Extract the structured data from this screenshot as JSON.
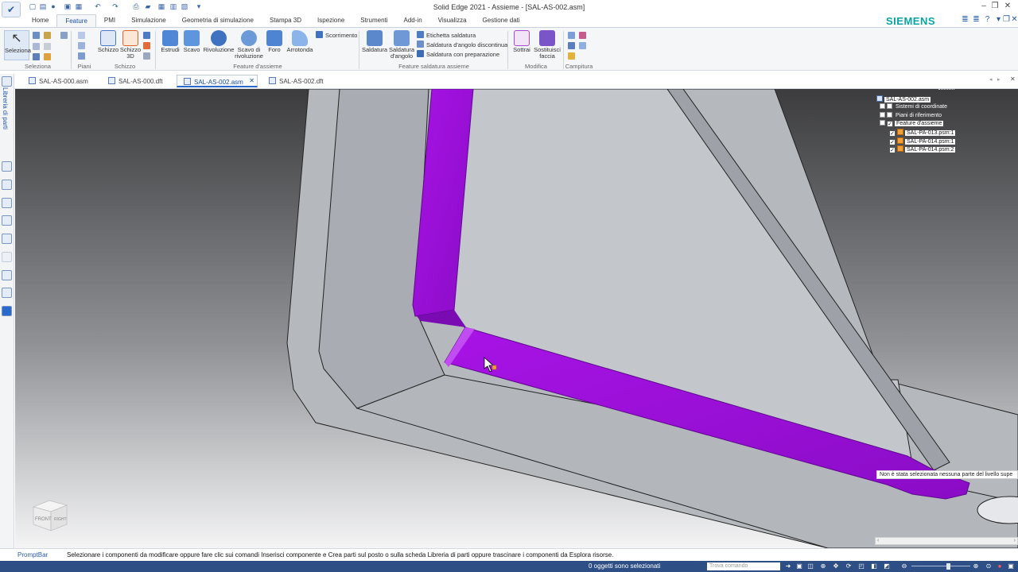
{
  "window": {
    "title": "Solid Edge 2021 - Assieme - [SAL-AS-002.asm]",
    "brand": "SIEMENS",
    "brand_color": "#0aa3a3",
    "accent_color": "#2a5ca8"
  },
  "ribbon": {
    "tabs": [
      "Home",
      "Feature",
      "PMI",
      "Simulazione",
      "Geometria di simulazione",
      "Stampa 3D",
      "Ispezione",
      "Strumenti",
      "Add-in",
      "Visualizza",
      "Gestione dati"
    ],
    "active_tab": "Feature",
    "groups": {
      "seleziona": {
        "label": "Seleziona",
        "select_button": "Seleziona"
      },
      "schizzo": {
        "label": "Schizzo",
        "planes_button": "Piani",
        "sketch_button": "Schizzo",
        "sketch3d_line1": "Schizzo",
        "sketch3d_line2": "3D"
      },
      "feature_assieme": {
        "label": "Feature d'assieme",
        "extrude": "Estrudi",
        "cut": "Scavo",
        "revolve": "Rivoluzione",
        "revolved_cut_line1": "Scavo di",
        "revolved_cut_line2": "rivoluzione",
        "hole": "Foro",
        "round": "Arrotonda",
        "sweep": "Scorrimento"
      },
      "saldatura": {
        "label": "Feature saldatura assieme",
        "weld": "Saldatura",
        "fillet_weld_line1": "Saldatura",
        "fillet_weld_line2": "d'angolo",
        "weld_label": "Etichetta saldatura",
        "intermittent": "Saldatura d'angolo discontinua",
        "groove": "Saldatura con preparazione"
      },
      "modifica": {
        "label": "Modifica",
        "subtract": "Sottrai",
        "replace_line1": "Sostituisci",
        "replace_line2": "faccia"
      },
      "campitura": {
        "label": "Campitura"
      }
    }
  },
  "documents": {
    "tabs": [
      {
        "name": "SAL-AS-000.asm"
      },
      {
        "name": "SAL-AS-000.dft"
      },
      {
        "name": "SAL-AS-002.asm"
      },
      {
        "name": "SAL-AS-002.dft"
      }
    ],
    "active": "SAL-AS-002.asm",
    "close_glyph": "✕"
  },
  "sidebar": {
    "library_label": "Libreria di parti"
  },
  "pathfinder": {
    "root": "SAL-AS-002.asm",
    "items": [
      {
        "label": "Sistemi di coordinate",
        "checked": false
      },
      {
        "label": "Piani di riferimento",
        "checked": false
      },
      {
        "label": "Feature d'assieme",
        "checked": true
      }
    ],
    "parts": [
      {
        "label": "SAL-PA-013.psm:1",
        "checked": true
      },
      {
        "label": "SAL-PA-014.psm:1",
        "checked": true
      },
      {
        "label": "SAL-PA-014.psm:2",
        "checked": true
      }
    ]
  },
  "tooltip": {
    "text": "Non è stata selezionata nessuna parte del livello supe"
  },
  "viewcube": {
    "front": "FRONT",
    "right": "RIGHT"
  },
  "promptbar": {
    "label": "PromptBar",
    "text": "Selezionare i componenti da modificare oppure fare clic sui comandi Inserisci componente e Crea parti sul posto o sulla scheda Libreria di parti oppure trascinare i componenti da Esplora risorse."
  },
  "status": {
    "selection": "0 oggetti sono selezionati",
    "find_placeholder": "Trova comando"
  },
  "colors": {
    "weld": "#9b0ed8",
    "part_face": "#bfc3c9",
    "status_bar": "#2e4f86"
  }
}
